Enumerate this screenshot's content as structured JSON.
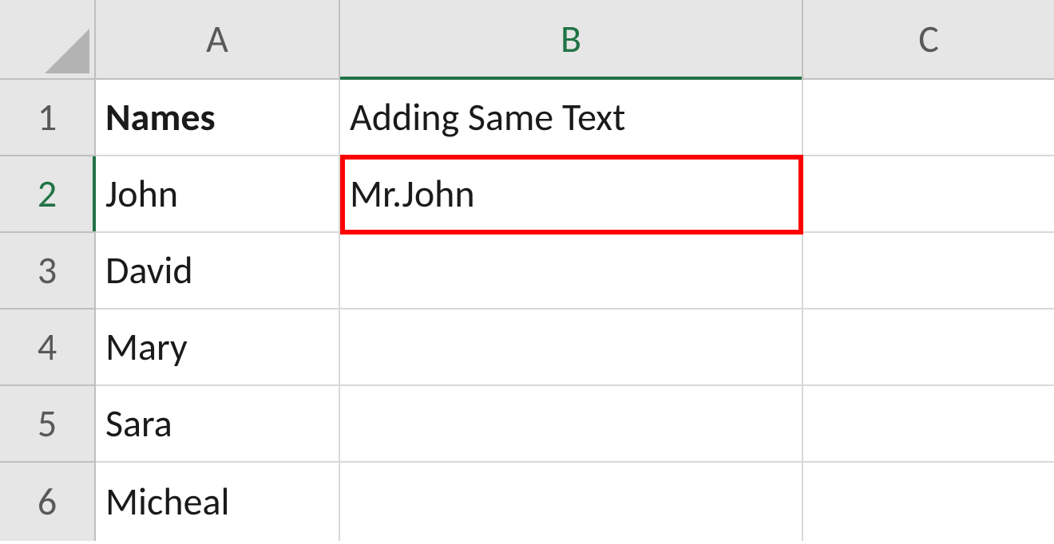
{
  "columns": {
    "A": "A",
    "B": "B",
    "C": "C"
  },
  "rows": {
    "r1": "1",
    "r2": "2",
    "r3": "3",
    "r4": "4",
    "r5": "5",
    "r6": "6"
  },
  "cells": {
    "A1": "Names",
    "B1": "Adding Same Text",
    "C1": "",
    "A2": "John",
    "B2": "Mr.John",
    "C2": "",
    "A3": "David",
    "B3": "",
    "C3": "",
    "A4": "Mary",
    "B4": "",
    "C4": "",
    "A5": "Sara",
    "B5": "",
    "C5": "",
    "A6": "Micheal",
    "B6": "",
    "C6": ""
  },
  "activeCell": "B2",
  "highlightColor": "#ff0000"
}
